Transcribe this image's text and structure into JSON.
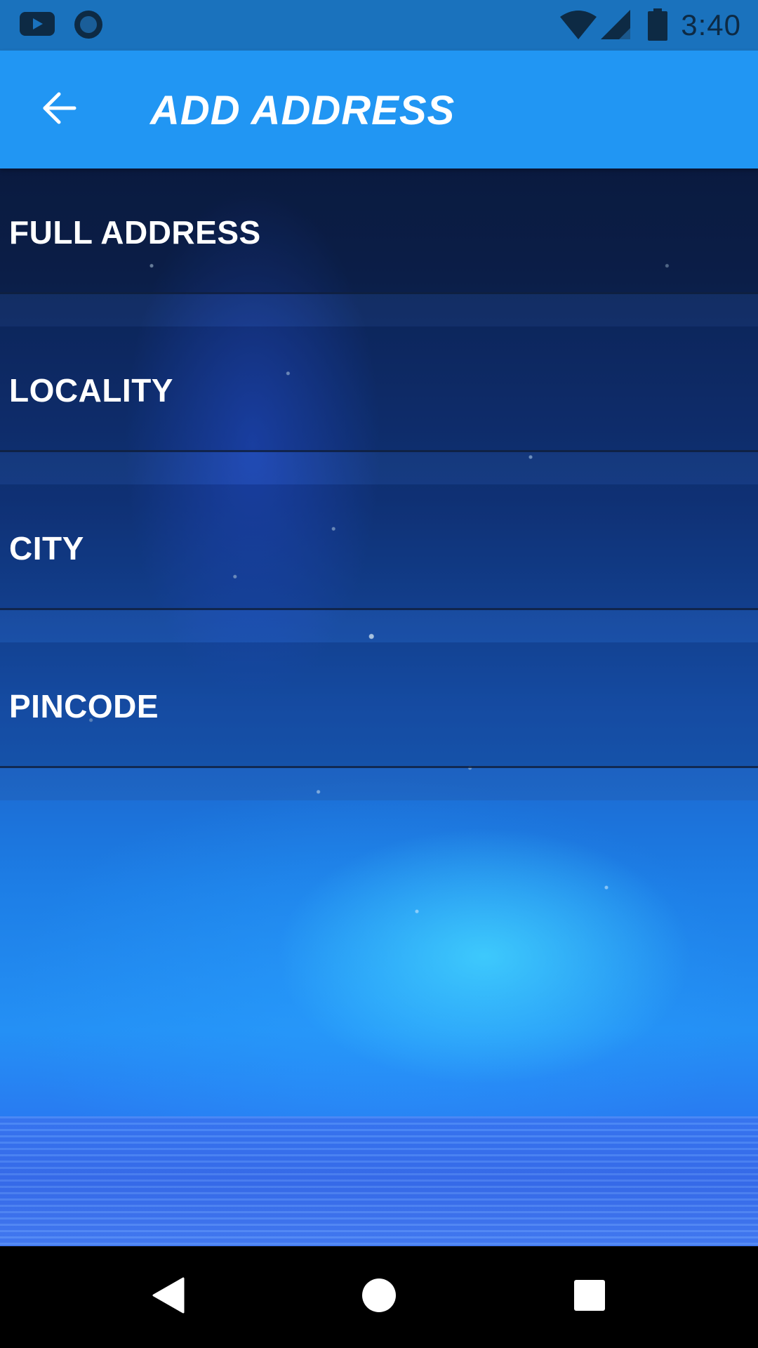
{
  "status_bar": {
    "time": "3:40",
    "icons": [
      "youtube-icon",
      "circle-app-icon",
      "wifi-icon",
      "cell-signal-icon",
      "battery-icon"
    ]
  },
  "app_bar": {
    "title": "ADD ADDRESS",
    "back_icon": "arrow-back-icon",
    "color": "#2196f3"
  },
  "form": {
    "fields": [
      {
        "label": "FULL ADDRESS",
        "value": ""
      },
      {
        "label": "LOCALITY",
        "value": ""
      },
      {
        "label": "CITY",
        "value": ""
      },
      {
        "label": "PINCODE",
        "value": ""
      }
    ]
  },
  "nav_bar": {
    "icons": [
      "back-triangle-icon",
      "home-circle-icon",
      "recents-square-icon"
    ]
  }
}
